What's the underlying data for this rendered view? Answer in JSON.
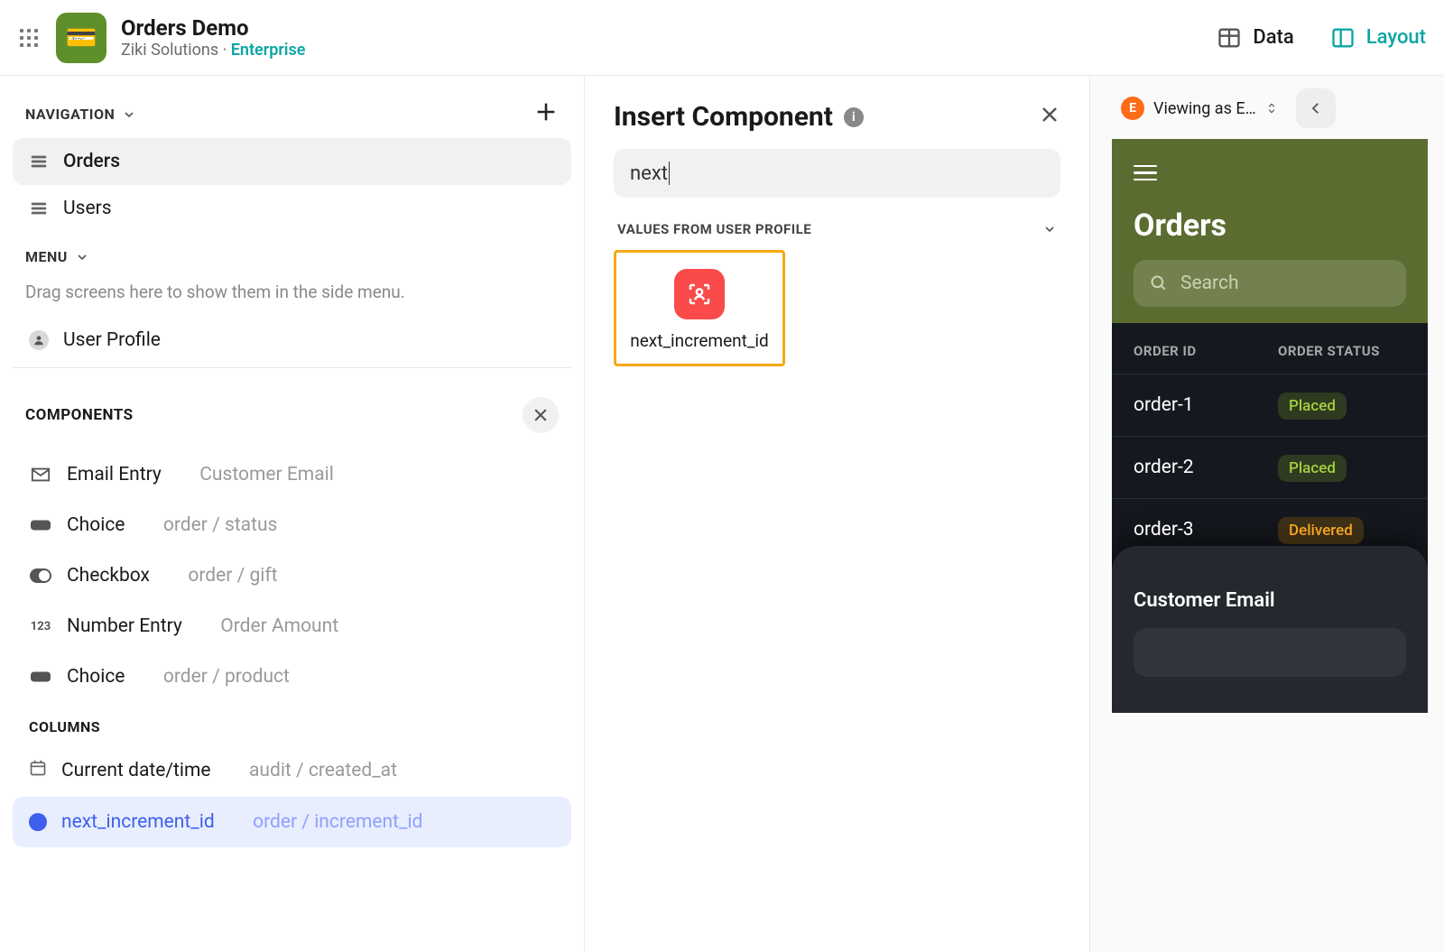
{
  "header": {
    "appTitle": "Orders Demo",
    "org": "Ziki Solutions",
    "plan": "Enterprise",
    "tabs": {
      "data": "Data",
      "layout": "Layout"
    }
  },
  "sidebar": {
    "navigationLabel": "NAVIGATION",
    "navItems": [
      "Orders",
      "Users"
    ],
    "menuLabel": "MENU",
    "menuHint": "Drag screens here to show them in the side menu.",
    "userProfile": "User Profile",
    "componentsLabel": "COMPONENTS",
    "components": [
      {
        "type": "Email Entry",
        "sub": "Customer Email"
      },
      {
        "type": "Choice",
        "sub": "order / status"
      },
      {
        "type": "Checkbox",
        "sub": "order / gift"
      },
      {
        "type": "Number Entry",
        "sub": "Order Amount"
      },
      {
        "type": "Choice",
        "sub": "order / product"
      }
    ],
    "columnsLabel": "COLUMNS",
    "columns": [
      {
        "name": "Current date/time",
        "sub": "audit / created_at"
      },
      {
        "name": "next_increment_id",
        "sub": "order / increment_id",
        "active": true
      }
    ]
  },
  "insert": {
    "title": "Insert Component",
    "search": "next",
    "groupLabel": "VALUES FROM USER PROFILE",
    "tile": "next_increment_id"
  },
  "preview": {
    "viewingAs": "Viewing as E…",
    "screenTitle": "Orders",
    "searchPlaceholder": "Search",
    "columns": [
      "ORDER ID",
      "ORDER STATUS"
    ],
    "rows": [
      {
        "id": "order-1",
        "status": "Placed",
        "pill": "placed"
      },
      {
        "id": "order-2",
        "status": "Placed",
        "pill": "placed"
      },
      {
        "id": "order-3",
        "status": "Delivered",
        "pill": "delivered"
      }
    ],
    "sheetLabel": "Customer Email"
  }
}
